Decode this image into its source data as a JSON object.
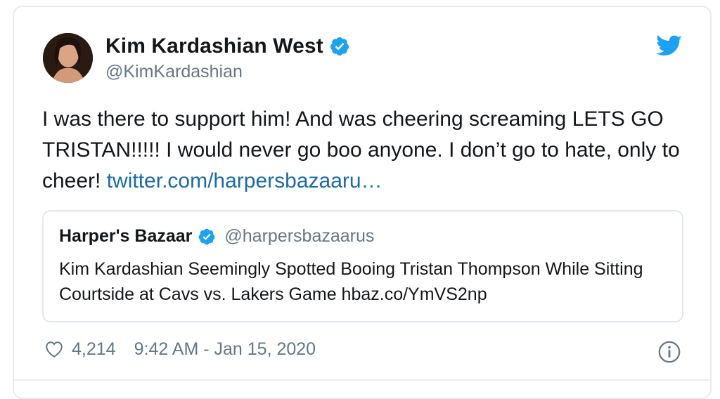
{
  "author": {
    "name": "Kim Kardashian West",
    "handle": "@KimKardashian"
  },
  "tweet": {
    "text": "I was there to support him! And was cheering screaming LETS GO TRISTAN!!!!! I would never go boo anyone. I don’t go to hate, only to cheer! ",
    "link_text": "twitter.com/harpersbazaaru…"
  },
  "quoted_tweet": {
    "name": "Harper's Bazaar",
    "handle": "@harpersbazaarus",
    "text": "Kim Kardashian Seemingly Spotted Booing Tristan Thompson While Sitting Courtside at Cavs vs. Lakers Game hbaz.co/YmVS2np"
  },
  "footer": {
    "like_count": "4,214",
    "timestamp": "9:42 AM - Jan 15, 2020"
  },
  "icons": {
    "verified": "verified-badge-icon",
    "brand": "twitter-bird-icon",
    "like": "heart-icon",
    "info": "info-icon"
  },
  "colors": {
    "verified_blue": "#1da1f2",
    "link_blue": "#1b6ba8",
    "secondary_text": "#657786",
    "border": "#e1e8ed"
  }
}
